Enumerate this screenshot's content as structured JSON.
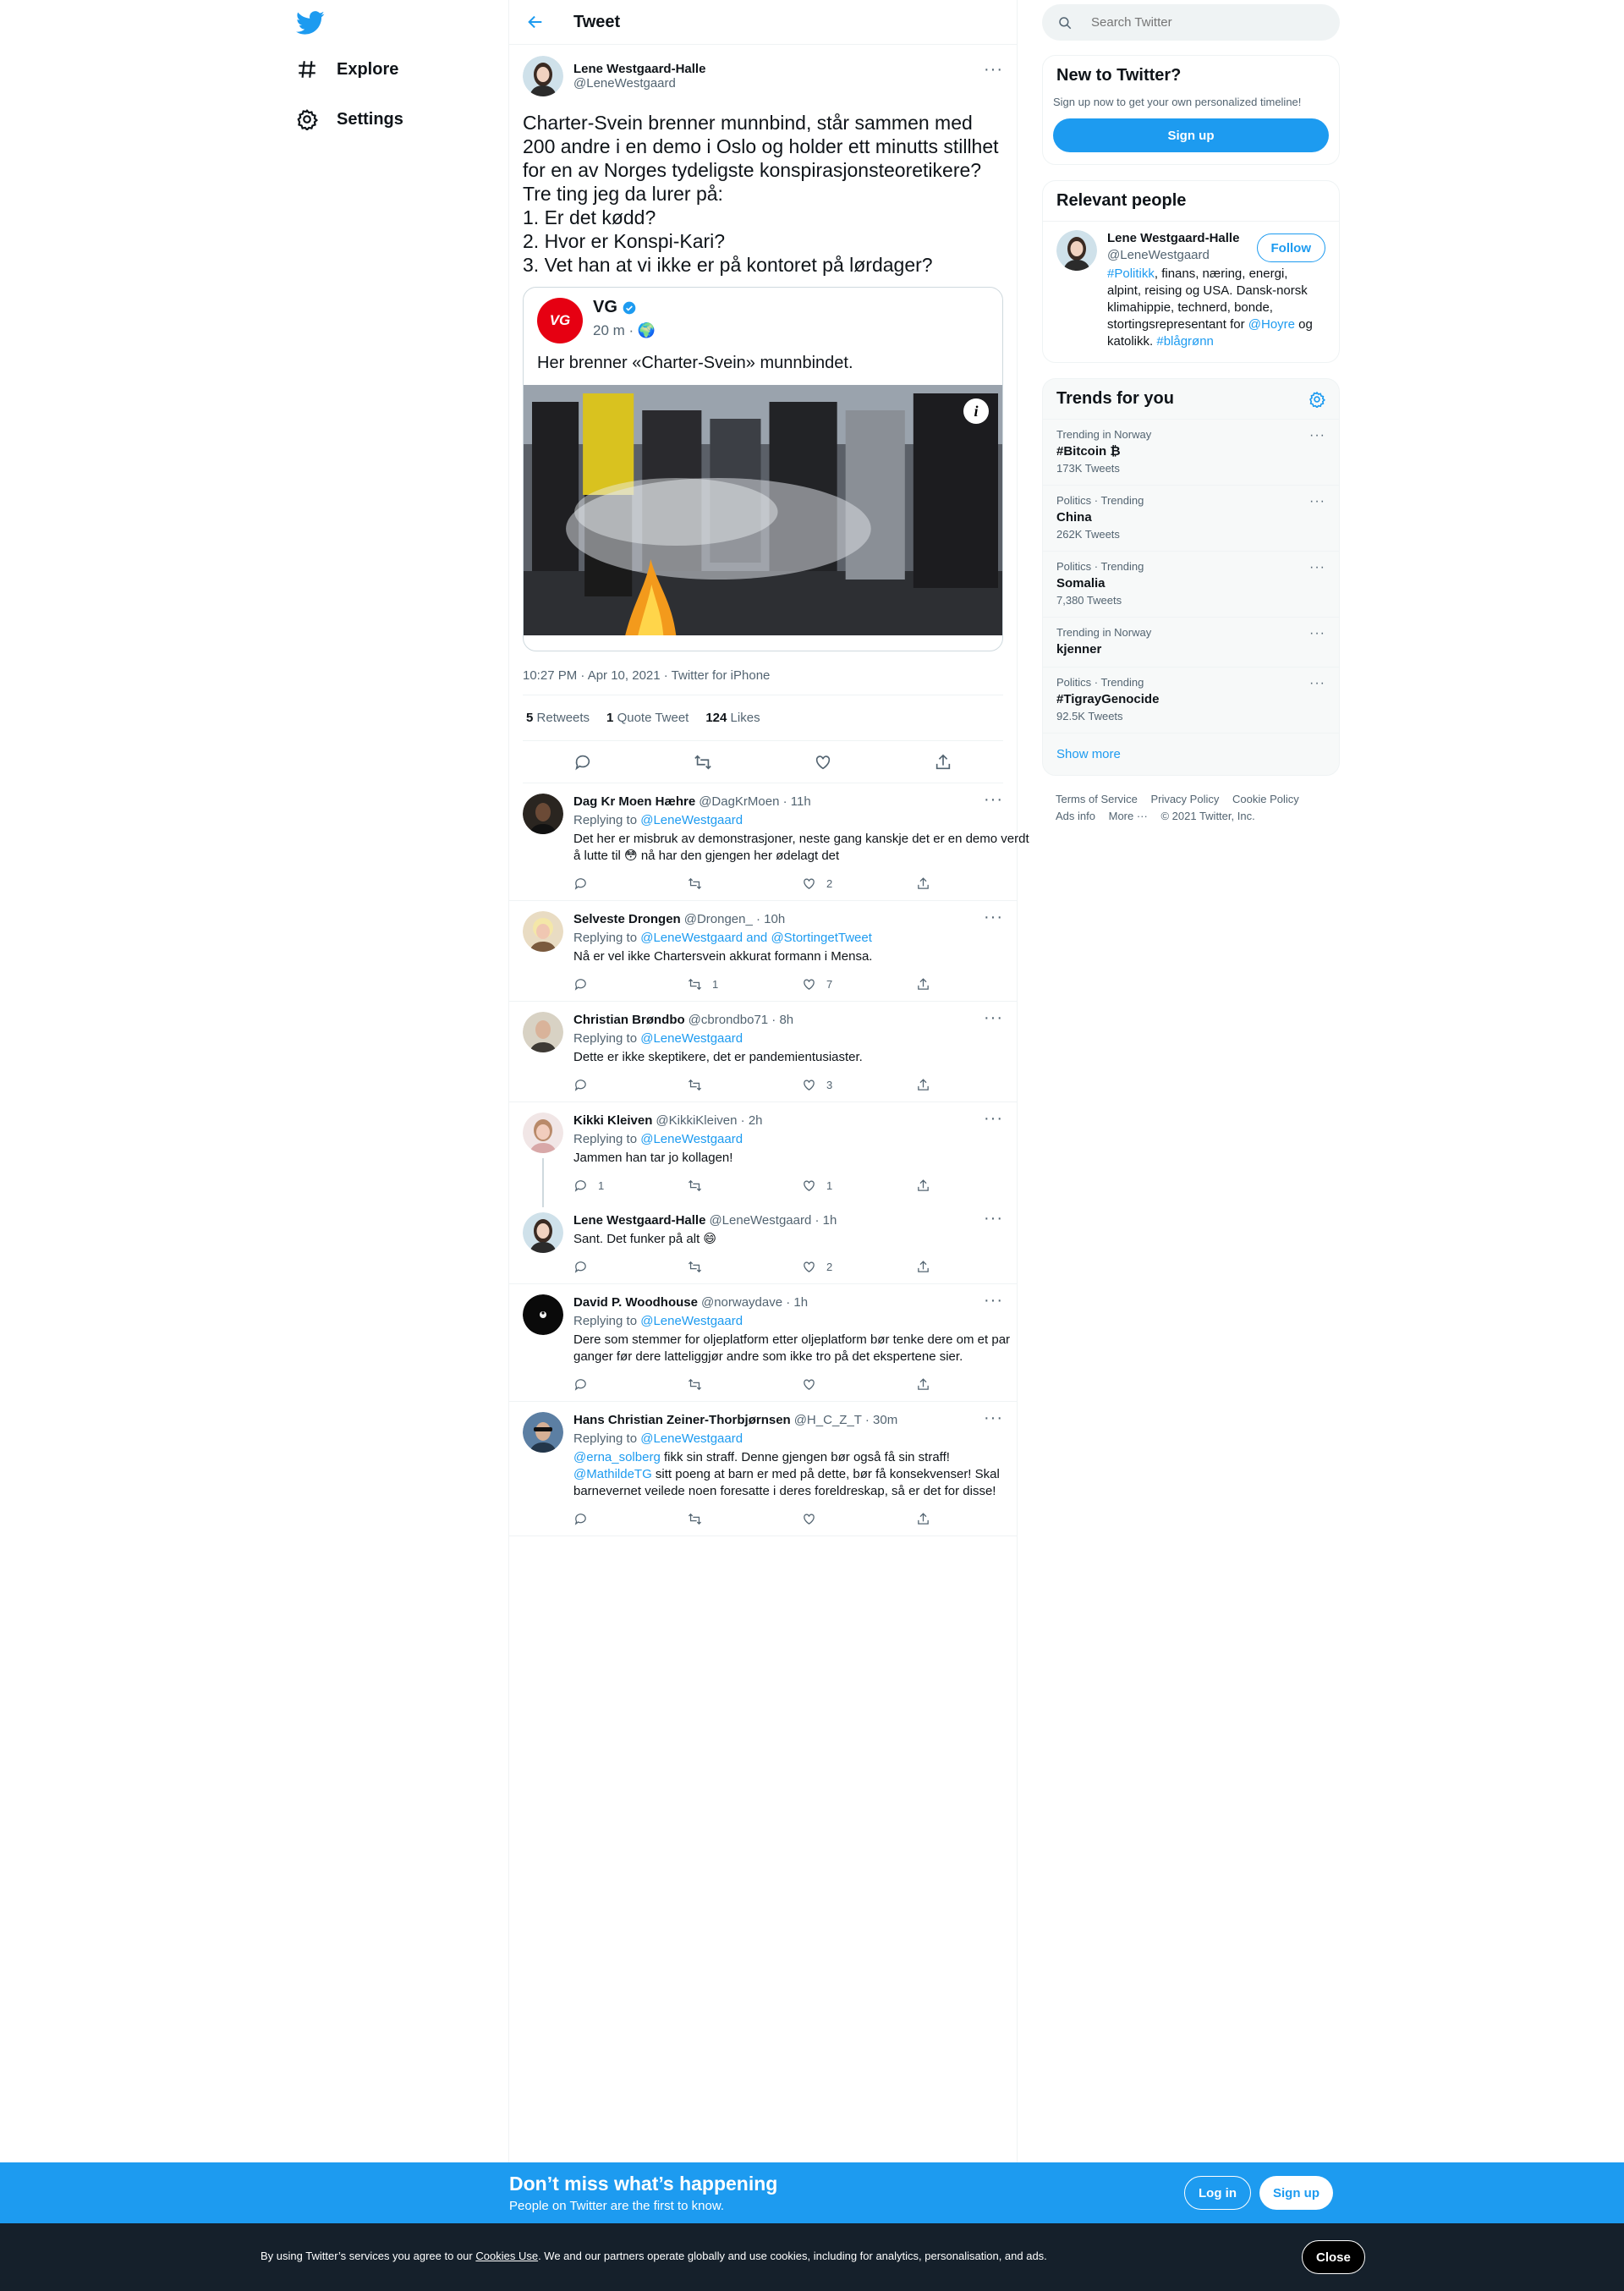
{
  "nav": {
    "items": [
      {
        "label": "Explore",
        "icon": "hashtag-icon"
      },
      {
        "label": "Settings",
        "icon": "gear-icon"
      }
    ]
  },
  "main": {
    "header_title": "Tweet",
    "tweet": {
      "author_name": "Lene Westgaard-Halle",
      "author_handle": "@LeneWestgaard",
      "text": "Charter-Svein brenner munnbind, står sammen med 200 andre i en demo i Oslo og holder ett minutts stillhet for en av Norges tydeligste konspirasjonsteoretikere?\nTre ting jeg da lurer på:\n1. Er det kødd?\n2. Hvor er Konspi-Kari?\n3. Vet han at vi ikke er på kontoret på lørdager?",
      "quote": {
        "name": "VG",
        "logo_text": "VG",
        "time": "20 m ·",
        "text": "Her brenner «Charter-Svein» munnbindet."
      },
      "meta": "10:27 PM · Apr 10, 2021 · Twitter for iPhone",
      "stats": {
        "retweets": "5",
        "retweets_label": "Retweets",
        "quotes": "1",
        "quotes_label": "Quote Tweet",
        "likes": "124",
        "likes_label": "Likes"
      }
    },
    "replies": [
      {
        "name": "Dag Kr Moen Hæhre",
        "handle": "@DagKrMoen · 11h",
        "replying": "Replying to",
        "replying_to": "@LeneWestgaard",
        "text": "Det her er misbruk av demonstrasjoner, neste gang kanskje det er en demo verdt å lutte til 😳 nå har den gjengen her ødelagt det",
        "replies": "",
        "retweets": "",
        "likes": "2"
      },
      {
        "name": "Selveste Drongen",
        "handle": "@Drongen_ · 10h",
        "replying": "Replying to",
        "replying_to": "@LeneWestgaard and @StortingetTweet",
        "text": "Nå er vel ikke Chartersvein akkurat formann i Mensa.",
        "replies": "",
        "retweets": "1",
        "likes": "7"
      },
      {
        "name": "Christian Brøndbo",
        "handle": "@cbrondbo71 · 8h",
        "replying": "Replying to",
        "replying_to": "@LeneWestgaard",
        "text": "Dette er ikke skeptikere, det er pandemientusiaster.",
        "replies": "",
        "retweets": "",
        "likes": "3"
      },
      {
        "name": "Kikki Kleiven",
        "handle": "@KikkiKleiven · 2h",
        "replying": "Replying to",
        "replying_to": "@LeneWestgaard",
        "text": "Jammen han tar jo kollagen!",
        "replies": "1",
        "retweets": "",
        "likes": "1"
      },
      {
        "name": "Lene Westgaard-Halle",
        "handle": "@LeneWestgaard · 1h",
        "text": "Sant. Det funker på alt 😄",
        "replies": "",
        "retweets": "",
        "likes": "2"
      },
      {
        "name": "David P. Woodhouse",
        "handle": "@norwaydave · 1h",
        "replying": "Replying to",
        "replying_to": "@LeneWestgaard",
        "text": "Dere som stemmer for oljeplatform etter oljeplatform bør tenke dere om et par ganger før dere latteliggjør andre som ikke tro på det ekspertene sier.",
        "replies": "",
        "retweets": "",
        "likes": ""
      },
      {
        "name": "Hans Christian Zeiner-Thorbjørnsen",
        "handle": "@H_C_Z_T · 30m",
        "replying": "Replying to",
        "replying_to": "@LeneWestgaard",
        "mention1": "@erna_solberg",
        "text1": " fikk sin straff. Denne gjengen bør også få sin straff!",
        "mention2": "@MathildeTG",
        "text2": " sitt poeng at barn er med på dette, bør få konsekvenser! Skal barnevernet veilede noen foresatte i deres foreldreskap, så er det for disse!",
        "replies": "",
        "retweets": "",
        "likes": ""
      }
    ]
  },
  "right": {
    "search_placeholder": "Search Twitter",
    "new_title": "New to Twitter?",
    "new_sub": "Sign up now to get your own personalized timeline!",
    "signup_label": "Sign up",
    "relevant_title": "Relevant people",
    "person": {
      "name": "Lene Westgaard-Halle",
      "handle": "@LeneWestgaard",
      "follow_label": "Follow",
      "bio_tag1": "#Politikk",
      "bio_text1": ", finans, næring, energi, alpint, reising og USA. Dansk-norsk klimahippie, technerd, bonde, stortingsrepresentant for ",
      "bio_mention": "@Hoyre",
      "bio_text2": " og katolikk. ",
      "bio_tag2": "#blågrønn"
    },
    "trends_title": "Trends for you",
    "trends": [
      {
        "context": "Trending in Norway",
        "name": "#Bitcoin ₿",
        "count": "173K Tweets"
      },
      {
        "context": "Politics · Trending",
        "name": "China",
        "count": "262K Tweets"
      },
      {
        "context": "Politics · Trending",
        "name": "Somalia",
        "count": "7,380 Tweets"
      },
      {
        "context": "Trending in Norway",
        "name": "kjenner",
        "count": ""
      },
      {
        "context": "Politics · Trending",
        "name": "#TigrayGenocide",
        "count": "92.5K Tweets"
      }
    ],
    "show_more": "Show more",
    "footer": [
      "Terms of Service",
      "Privacy Policy",
      "Cookie Policy",
      "Ads info",
      "More ···",
      "© 2021 Twitter, Inc."
    ]
  },
  "bottom_bar": {
    "title": "Don’t miss what’s happening",
    "subtitle": "People on Twitter are the first to know.",
    "login_label": "Log in",
    "signup_label": "Sign up"
  },
  "cookie_bar": {
    "text_before": "By using Twitter’s services you agree to our ",
    "link": "Cookies Use",
    "text_after": ". We and our partners operate globally and use cookies, including for analytics, personalisation, and ads.",
    "close_label": "Close"
  },
  "colors": {
    "accent": "#1d9bf0",
    "vg_red": "#e60012",
    "cookie_bg": "#15202b"
  }
}
